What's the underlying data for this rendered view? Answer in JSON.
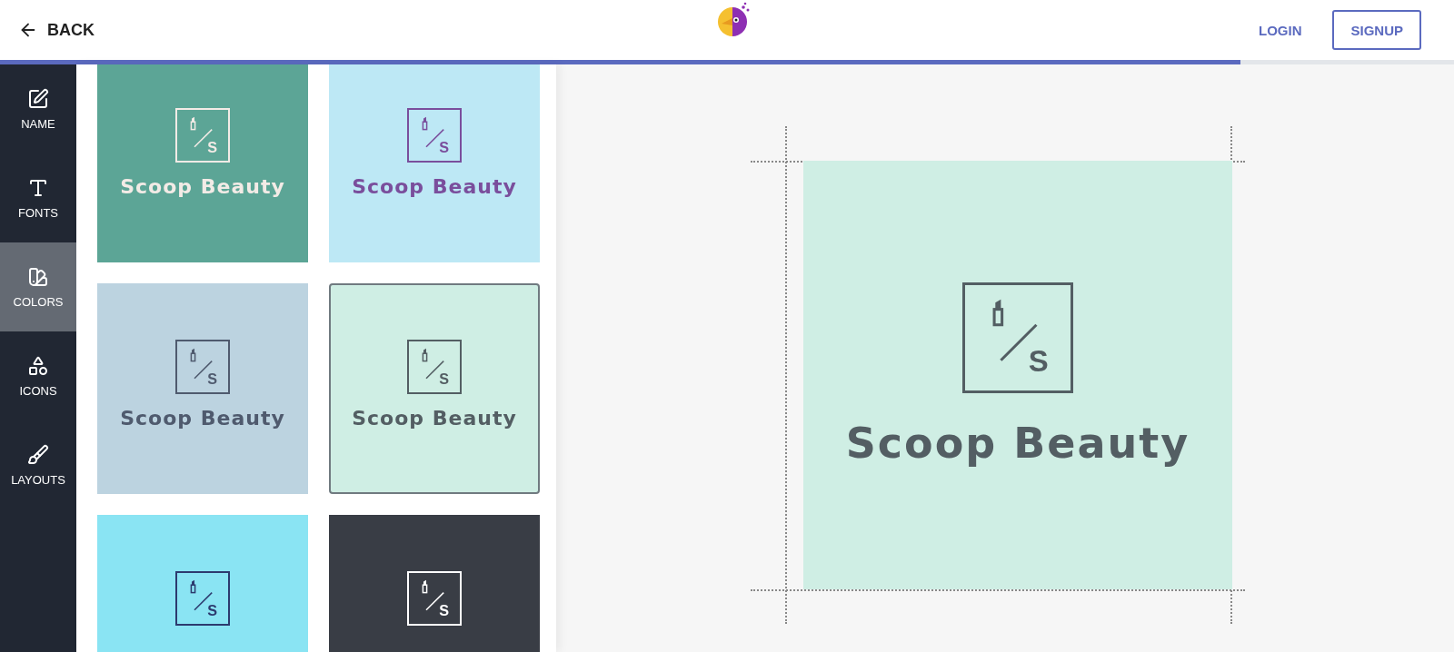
{
  "header": {
    "back": "BACK",
    "login": "LOGIN",
    "signup": "SIGNUP",
    "progress": {
      "level": 0.853
    }
  },
  "sidebar": {
    "items": [
      {
        "kind": "name",
        "label": "NAME",
        "selected": false
      },
      {
        "kind": "fonts",
        "label": "FONTS",
        "selected": false
      },
      {
        "kind": "colors",
        "label": "COLORS",
        "selected": true
      },
      {
        "kind": "icons",
        "label": "ICONS",
        "selected": false
      },
      {
        "kind": "layouts",
        "label": "LAYOUTS",
        "selected": false
      }
    ]
  },
  "palettes": [
    {
      "color": "#5ca596",
      "ink": {
        "color": "#f3ebe6"
      },
      "mark_letter": "S",
      "name": "Scoop Beauty",
      "selected": false
    },
    {
      "color": "#bde8f5",
      "ink": {
        "color": "#7a4e9c"
      },
      "mark_letter": "S",
      "name": "Scoop Beauty",
      "selected": false
    },
    {
      "color": "#bcd3e0",
      "ink": {
        "color": "#4f5a6e"
      },
      "mark_letter": "S",
      "name": "Scoop Beauty",
      "selected": false
    },
    {
      "color": "#cfeee4",
      "ink": {
        "color": "#535e63"
      },
      "mark_letter": "S",
      "name": "Scoop Beauty",
      "selected": true
    },
    {
      "color": "#8ae4f3",
      "ink": {
        "color": "#2c3a6e"
      },
      "mark_letter": "S",
      "selected": false
    },
    {
      "color": "#393d45",
      "ink": {
        "color": "#ffffff"
      },
      "mark_letter": "S",
      "selected": false
    }
  ],
  "preview": {
    "color": "#cfeee4",
    "ink": {
      "color": "#535e63"
    },
    "mark_letter": "S",
    "name": "Scoop Beauty"
  }
}
